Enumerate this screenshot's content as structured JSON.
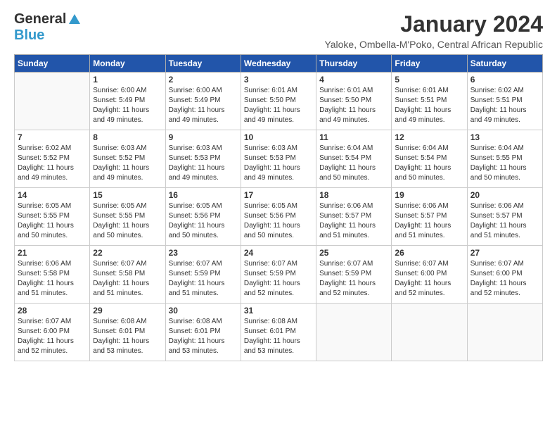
{
  "logo": {
    "general": "General",
    "blue": "Blue"
  },
  "title": "January 2024",
  "subtitle": "Yaloke, Ombella-M'Poko, Central African Republic",
  "days_of_week": [
    "Sunday",
    "Monday",
    "Tuesday",
    "Wednesday",
    "Thursday",
    "Friday",
    "Saturday"
  ],
  "weeks": [
    [
      {
        "day": "",
        "info": ""
      },
      {
        "day": "1",
        "info": "Sunrise: 6:00 AM\nSunset: 5:49 PM\nDaylight: 11 hours\nand 49 minutes."
      },
      {
        "day": "2",
        "info": "Sunrise: 6:00 AM\nSunset: 5:49 PM\nDaylight: 11 hours\nand 49 minutes."
      },
      {
        "day": "3",
        "info": "Sunrise: 6:01 AM\nSunset: 5:50 PM\nDaylight: 11 hours\nand 49 minutes."
      },
      {
        "day": "4",
        "info": "Sunrise: 6:01 AM\nSunset: 5:50 PM\nDaylight: 11 hours\nand 49 minutes."
      },
      {
        "day": "5",
        "info": "Sunrise: 6:01 AM\nSunset: 5:51 PM\nDaylight: 11 hours\nand 49 minutes."
      },
      {
        "day": "6",
        "info": "Sunrise: 6:02 AM\nSunset: 5:51 PM\nDaylight: 11 hours\nand 49 minutes."
      }
    ],
    [
      {
        "day": "7",
        "info": "Sunrise: 6:02 AM\nSunset: 5:52 PM\nDaylight: 11 hours\nand 49 minutes."
      },
      {
        "day": "8",
        "info": "Sunrise: 6:03 AM\nSunset: 5:52 PM\nDaylight: 11 hours\nand 49 minutes."
      },
      {
        "day": "9",
        "info": "Sunrise: 6:03 AM\nSunset: 5:53 PM\nDaylight: 11 hours\nand 49 minutes."
      },
      {
        "day": "10",
        "info": "Sunrise: 6:03 AM\nSunset: 5:53 PM\nDaylight: 11 hours\nand 49 minutes."
      },
      {
        "day": "11",
        "info": "Sunrise: 6:04 AM\nSunset: 5:54 PM\nDaylight: 11 hours\nand 50 minutes."
      },
      {
        "day": "12",
        "info": "Sunrise: 6:04 AM\nSunset: 5:54 PM\nDaylight: 11 hours\nand 50 minutes."
      },
      {
        "day": "13",
        "info": "Sunrise: 6:04 AM\nSunset: 5:55 PM\nDaylight: 11 hours\nand 50 minutes."
      }
    ],
    [
      {
        "day": "14",
        "info": "Sunrise: 6:05 AM\nSunset: 5:55 PM\nDaylight: 11 hours\nand 50 minutes."
      },
      {
        "day": "15",
        "info": "Sunrise: 6:05 AM\nSunset: 5:55 PM\nDaylight: 11 hours\nand 50 minutes."
      },
      {
        "day": "16",
        "info": "Sunrise: 6:05 AM\nSunset: 5:56 PM\nDaylight: 11 hours\nand 50 minutes."
      },
      {
        "day": "17",
        "info": "Sunrise: 6:05 AM\nSunset: 5:56 PM\nDaylight: 11 hours\nand 50 minutes."
      },
      {
        "day": "18",
        "info": "Sunrise: 6:06 AM\nSunset: 5:57 PM\nDaylight: 11 hours\nand 51 minutes."
      },
      {
        "day": "19",
        "info": "Sunrise: 6:06 AM\nSunset: 5:57 PM\nDaylight: 11 hours\nand 51 minutes."
      },
      {
        "day": "20",
        "info": "Sunrise: 6:06 AM\nSunset: 5:57 PM\nDaylight: 11 hours\nand 51 minutes."
      }
    ],
    [
      {
        "day": "21",
        "info": "Sunrise: 6:06 AM\nSunset: 5:58 PM\nDaylight: 11 hours\nand 51 minutes."
      },
      {
        "day": "22",
        "info": "Sunrise: 6:07 AM\nSunset: 5:58 PM\nDaylight: 11 hours\nand 51 minutes."
      },
      {
        "day": "23",
        "info": "Sunrise: 6:07 AM\nSunset: 5:59 PM\nDaylight: 11 hours\nand 51 minutes."
      },
      {
        "day": "24",
        "info": "Sunrise: 6:07 AM\nSunset: 5:59 PM\nDaylight: 11 hours\nand 52 minutes."
      },
      {
        "day": "25",
        "info": "Sunrise: 6:07 AM\nSunset: 5:59 PM\nDaylight: 11 hours\nand 52 minutes."
      },
      {
        "day": "26",
        "info": "Sunrise: 6:07 AM\nSunset: 6:00 PM\nDaylight: 11 hours\nand 52 minutes."
      },
      {
        "day": "27",
        "info": "Sunrise: 6:07 AM\nSunset: 6:00 PM\nDaylight: 11 hours\nand 52 minutes."
      }
    ],
    [
      {
        "day": "28",
        "info": "Sunrise: 6:07 AM\nSunset: 6:00 PM\nDaylight: 11 hours\nand 52 minutes."
      },
      {
        "day": "29",
        "info": "Sunrise: 6:08 AM\nSunset: 6:01 PM\nDaylight: 11 hours\nand 53 minutes."
      },
      {
        "day": "30",
        "info": "Sunrise: 6:08 AM\nSunset: 6:01 PM\nDaylight: 11 hours\nand 53 minutes."
      },
      {
        "day": "31",
        "info": "Sunrise: 6:08 AM\nSunset: 6:01 PM\nDaylight: 11 hours\nand 53 minutes."
      },
      {
        "day": "",
        "info": ""
      },
      {
        "day": "",
        "info": ""
      },
      {
        "day": "",
        "info": ""
      }
    ]
  ]
}
